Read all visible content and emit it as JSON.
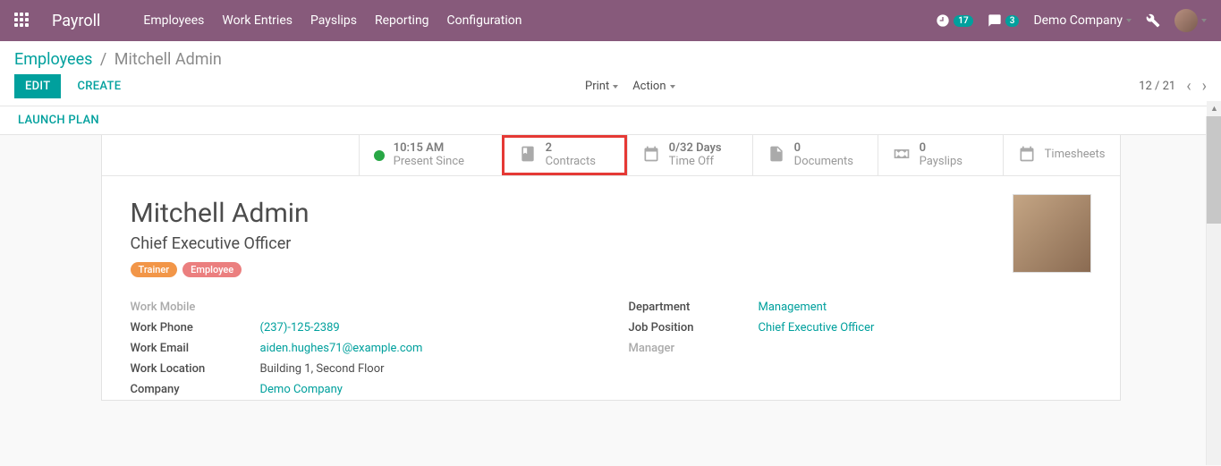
{
  "app": {
    "title": "Payroll"
  },
  "nav": {
    "items": [
      "Employees",
      "Work Entries",
      "Payslips",
      "Reporting",
      "Configuration"
    ]
  },
  "systray": {
    "activity_count": "17",
    "message_count": "3",
    "company": "Demo Company"
  },
  "breadcrumb": {
    "root": "Employees",
    "current": "Mitchell Admin"
  },
  "toolbar": {
    "edit": "EDIT",
    "create": "CREATE",
    "print": "Print",
    "action": "Action",
    "pager": "12 / 21",
    "launch_plan": "LAUNCH PLAN"
  },
  "stats": {
    "presence_time": "10:15 AM",
    "presence_label": "Present Since",
    "contracts_val": "2",
    "contracts_lbl": "Contracts",
    "timeoff_val": "0/32 Days",
    "timeoff_lbl": "Time Off",
    "docs_val": "0",
    "docs_lbl": "Documents",
    "payslips_val": "0",
    "payslips_lbl": "Payslips",
    "timesheets_lbl": "Timesheets"
  },
  "employee": {
    "name": "Mitchell Admin",
    "job_title": "Chief Executive Officer",
    "tags": [
      "Trainer",
      "Employee"
    ]
  },
  "fields": {
    "work_mobile_lbl": "Work Mobile",
    "work_mobile_val": "",
    "work_phone_lbl": "Work Phone",
    "work_phone_val": "(237)-125-2389",
    "work_email_lbl": "Work Email",
    "work_email_val": "aiden.hughes71@example.com",
    "work_location_lbl": "Work Location",
    "work_location_val": "Building 1, Second Floor",
    "company_lbl": "Company",
    "company_val": "Demo Company",
    "department_lbl": "Department",
    "department_val": "Management",
    "job_position_lbl": "Job Position",
    "job_position_val": "Chief Executive Officer",
    "manager_lbl": "Manager",
    "manager_val": ""
  }
}
